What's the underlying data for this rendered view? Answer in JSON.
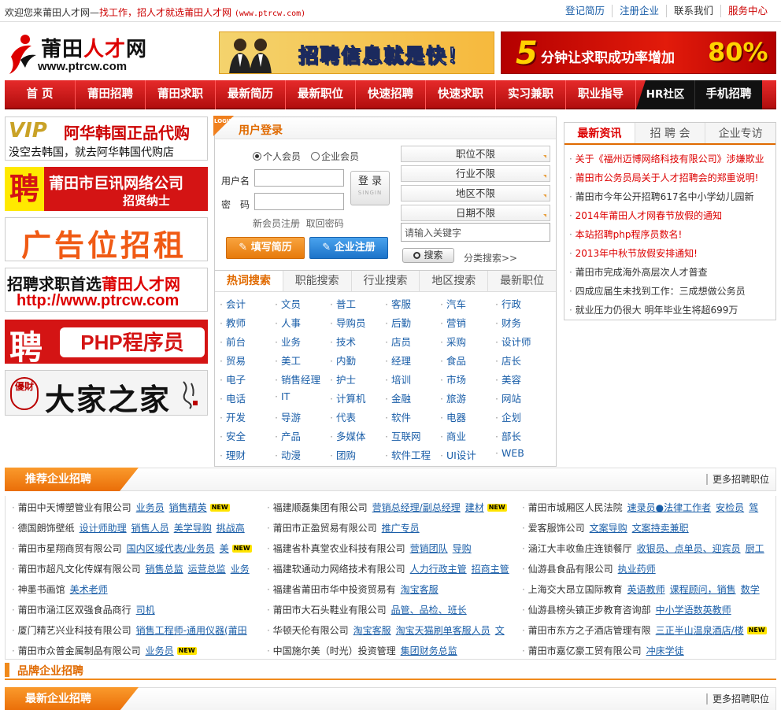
{
  "topbar": {
    "welcome": "欢迎您来莆田人才网—",
    "slogan": "找工作，招人才就选莆田人才网",
    "url": "(www.ptrcw.com)",
    "links": [
      "登记简历",
      "注册企业",
      "联系我们",
      "服务中心"
    ]
  },
  "logo": {
    "name_a": "莆田",
    "name_b": "人才",
    "name_c": "网",
    "domain": "www.ptrcw.com"
  },
  "banners": {
    "b1_text": "招聘信息就是快！",
    "b2_num": "5",
    "b2_text": "分钟让求职成功率增加",
    "b2_pct": "80%"
  },
  "nav": {
    "items": [
      "首 页",
      "莆田招聘",
      "莆田求职",
      "最新简历",
      "最新职位",
      "快速招聘",
      "快速求职",
      "实习兼职",
      "职业指导"
    ],
    "hr": "HR社区",
    "mobile": "手机招聘"
  },
  "ads": {
    "ad1": {
      "vip": "VIP",
      "title": "阿华韩国正品代购",
      "sub": "没空去韩国，就去阿华韩国代购店"
    },
    "ad2": {
      "pin": "聘",
      "title": "莆田市巨讯网络公司",
      "sub": "招贤纳士"
    },
    "ad3": {
      "title": "广告位招租"
    },
    "ad4": {
      "title_a": "招聘求职首选",
      "title_b": "莆田人才网",
      "url": "http://www.ptrcw.com"
    },
    "ad5": {
      "pin": "聘",
      "title": "PHP程序员"
    },
    "ad6": {
      "seal": "優財",
      "title": "大家之家"
    }
  },
  "login": {
    "tag": "LOGIN",
    "title": "用户登录",
    "radio_personal": "个人会员",
    "radio_company": "企业会员",
    "username_label": "用户名",
    "password_label": "密　码",
    "login_btn": "登 录",
    "login_btn_en": "SINGIN",
    "register_link": "新会员注册",
    "forgot_link": "取回密码",
    "resume_btn": "填写简历",
    "company_btn": "企业注册",
    "selects": [
      "职位不限",
      "行业不限",
      "地区不限",
      "日期不限"
    ],
    "keyword_placeholder": "请输入关键字",
    "search_btn": "搜索",
    "category_search": "分类搜索>>"
  },
  "hot": {
    "tabs": [
      "热词搜索",
      "职能搜索",
      "行业搜索",
      "地区搜索",
      "最新职位"
    ],
    "words": [
      "会计",
      "文员",
      "普工",
      "客服",
      "汽车",
      "行政",
      "教师",
      "人事",
      "导购员",
      "后勤",
      "营销",
      "财务",
      "前台",
      "业务",
      "技术",
      "店员",
      "采购",
      "设计师",
      "贸易",
      "美工",
      "内勤",
      "经理",
      "食品",
      "店长",
      "电子",
      "销售经理",
      "护士",
      "培训",
      "市场",
      "美容",
      "电话",
      "IT",
      "计算机",
      "金融",
      "旅游",
      "网站",
      "开发",
      "导游",
      "代表",
      "软件",
      "电器",
      "企划",
      "安全",
      "产品",
      "多媒体",
      "互联网",
      "商业",
      "部长",
      "理财",
      "动漫",
      "团购",
      "软件工程",
      "UI设计",
      "WEB"
    ]
  },
  "news": {
    "tabs": [
      "最新资讯",
      "招 聘 会",
      "企业专访"
    ],
    "items": [
      {
        "text": "关于《福州迈博网络科技有限公司》涉嫌欺业",
        "color": "red"
      },
      {
        "text": "莆田市公务员局关于人才招聘会的郑重说明!",
        "color": "red"
      },
      {
        "text": "莆田市今年公开招聘617名中小学幼儿园新",
        "color": "blk"
      },
      {
        "text": "2014年莆田人才网春节放假的通知",
        "color": "red"
      },
      {
        "text": "本站招聘php程序员数名!",
        "color": "red"
      },
      {
        "text": "2013年中秋节放假安排通知!",
        "color": "red"
      },
      {
        "text": "莆田市完成海外高层次人才普查",
        "color": "blk"
      },
      {
        "text": "四成应届生未找到工作：三成想做公务员",
        "color": "blk"
      },
      {
        "text": "就业压力仍很大 明年毕业生将超699万",
        "color": "blk"
      }
    ]
  },
  "recommend": {
    "title": "推荐企业招聘",
    "more": "更多招聘职位",
    "rows": [
      [
        {
          "c": "莆田中天博塑管业有限公司",
          "j": [
            "业务员",
            "销售精英"
          ],
          "n": true
        },
        {
          "c": "福建顺磊集团有限公司",
          "j": [
            "营销总经理/副总经理",
            "建材"
          ],
          "n": true
        },
        {
          "c": "莆田市城厢区人民法院",
          "j": [
            "速录员●法律工作者",
            "安检员",
            "驾"
          ],
          "n": false
        }
      ],
      [
        {
          "c": "德国朗饰壁纸",
          "j": [
            "设计师助理",
            "销售人员",
            "美学导购",
            "挑战高"
          ],
          "n": false
        },
        {
          "c": "莆田市正盈贸易有限公司",
          "j": [
            "推广专员"
          ],
          "n": false
        },
        {
          "c": "爱客服饰公司",
          "j": [
            "文案导购",
            "文案持卖兼职"
          ],
          "n": false
        }
      ],
      [
        {
          "c": "莆田市星翔商贸有限公司",
          "j": [
            "国内区域代表/业务员",
            "美"
          ],
          "n": true
        },
        {
          "c": "福建省朴真堂农业科技有限公司",
          "j": [
            "营销团队",
            "导购"
          ],
          "n": false
        },
        {
          "c": "涵江大丰收鱼庄连锁餐厅",
          "j": [
            "收银员、点单员、迎宾员",
            "厨工"
          ],
          "n": false
        }
      ],
      [
        {
          "c": "莆田市超凡文化传媒有限公司",
          "j": [
            "销售总监",
            "运营总监",
            "业务"
          ],
          "n": false
        },
        {
          "c": "福建软通动力网络技术有限公司",
          "j": [
            "人力行政主管",
            "招商主管"
          ],
          "n": false
        },
        {
          "c": "仙游县食品有限公司",
          "j": [
            "执业药师"
          ],
          "n": false
        }
      ],
      [
        {
          "c": "神墨书画馆",
          "j": [
            "美术老师"
          ],
          "n": false
        },
        {
          "c": "福建省莆田市华中投资贸易有",
          "j": [
            "淘宝客服"
          ],
          "n": false
        },
        {
          "c": "上海交大昂立国际教育",
          "j": [
            "英语教师",
            "课程顾问，销售",
            "数学"
          ],
          "n": false
        }
      ],
      [
        {
          "c": "莆田市涵江区双强食品商行",
          "j": [
            "司机"
          ],
          "n": false
        },
        {
          "c": "莆田市大石头鞋业有限公司",
          "j": [
            "品管、品检、班长"
          ],
          "n": false
        },
        {
          "c": "仙游县榜头镇正步教育咨询部",
          "j": [
            "中小学语数英教师"
          ],
          "n": false
        }
      ],
      [
        {
          "c": "厦门精艺兴业科技有限公司",
          "j": [
            "销售工程师-通用仪器(莆田"
          ],
          "n": false
        },
        {
          "c": "华顿天伦有限公司",
          "j": [
            "淘宝客服",
            "淘宝天猫刷单客服人员",
            "文"
          ],
          "n": false
        },
        {
          "c": "莆田市东方之子酒店管理有限",
          "j": [
            "三正半山温泉酒店/楼"
          ],
          "n": true
        }
      ],
      [
        {
          "c": "莆田市众普金属制品有限公司",
          "j": [
            "业务员"
          ],
          "n": true
        },
        {
          "c": "中国施尔美（时光）投资管理",
          "j": [
            "集团财务总监"
          ],
          "n": false
        },
        {
          "c": "莆田市嘉亿豪工贸有限公司",
          "j": [
            "冲床学徒"
          ],
          "n": false
        }
      ]
    ],
    "new_badge": "NEW"
  },
  "brand": {
    "title": "品牌企业招聘"
  },
  "latest": {
    "title": "最新企业招聘",
    "more": "更多招聘职位"
  },
  "colors": {
    "accent_red": "#d41414",
    "accent_orange": "#ea6e08",
    "link_blue": "#1a5ea8"
  }
}
